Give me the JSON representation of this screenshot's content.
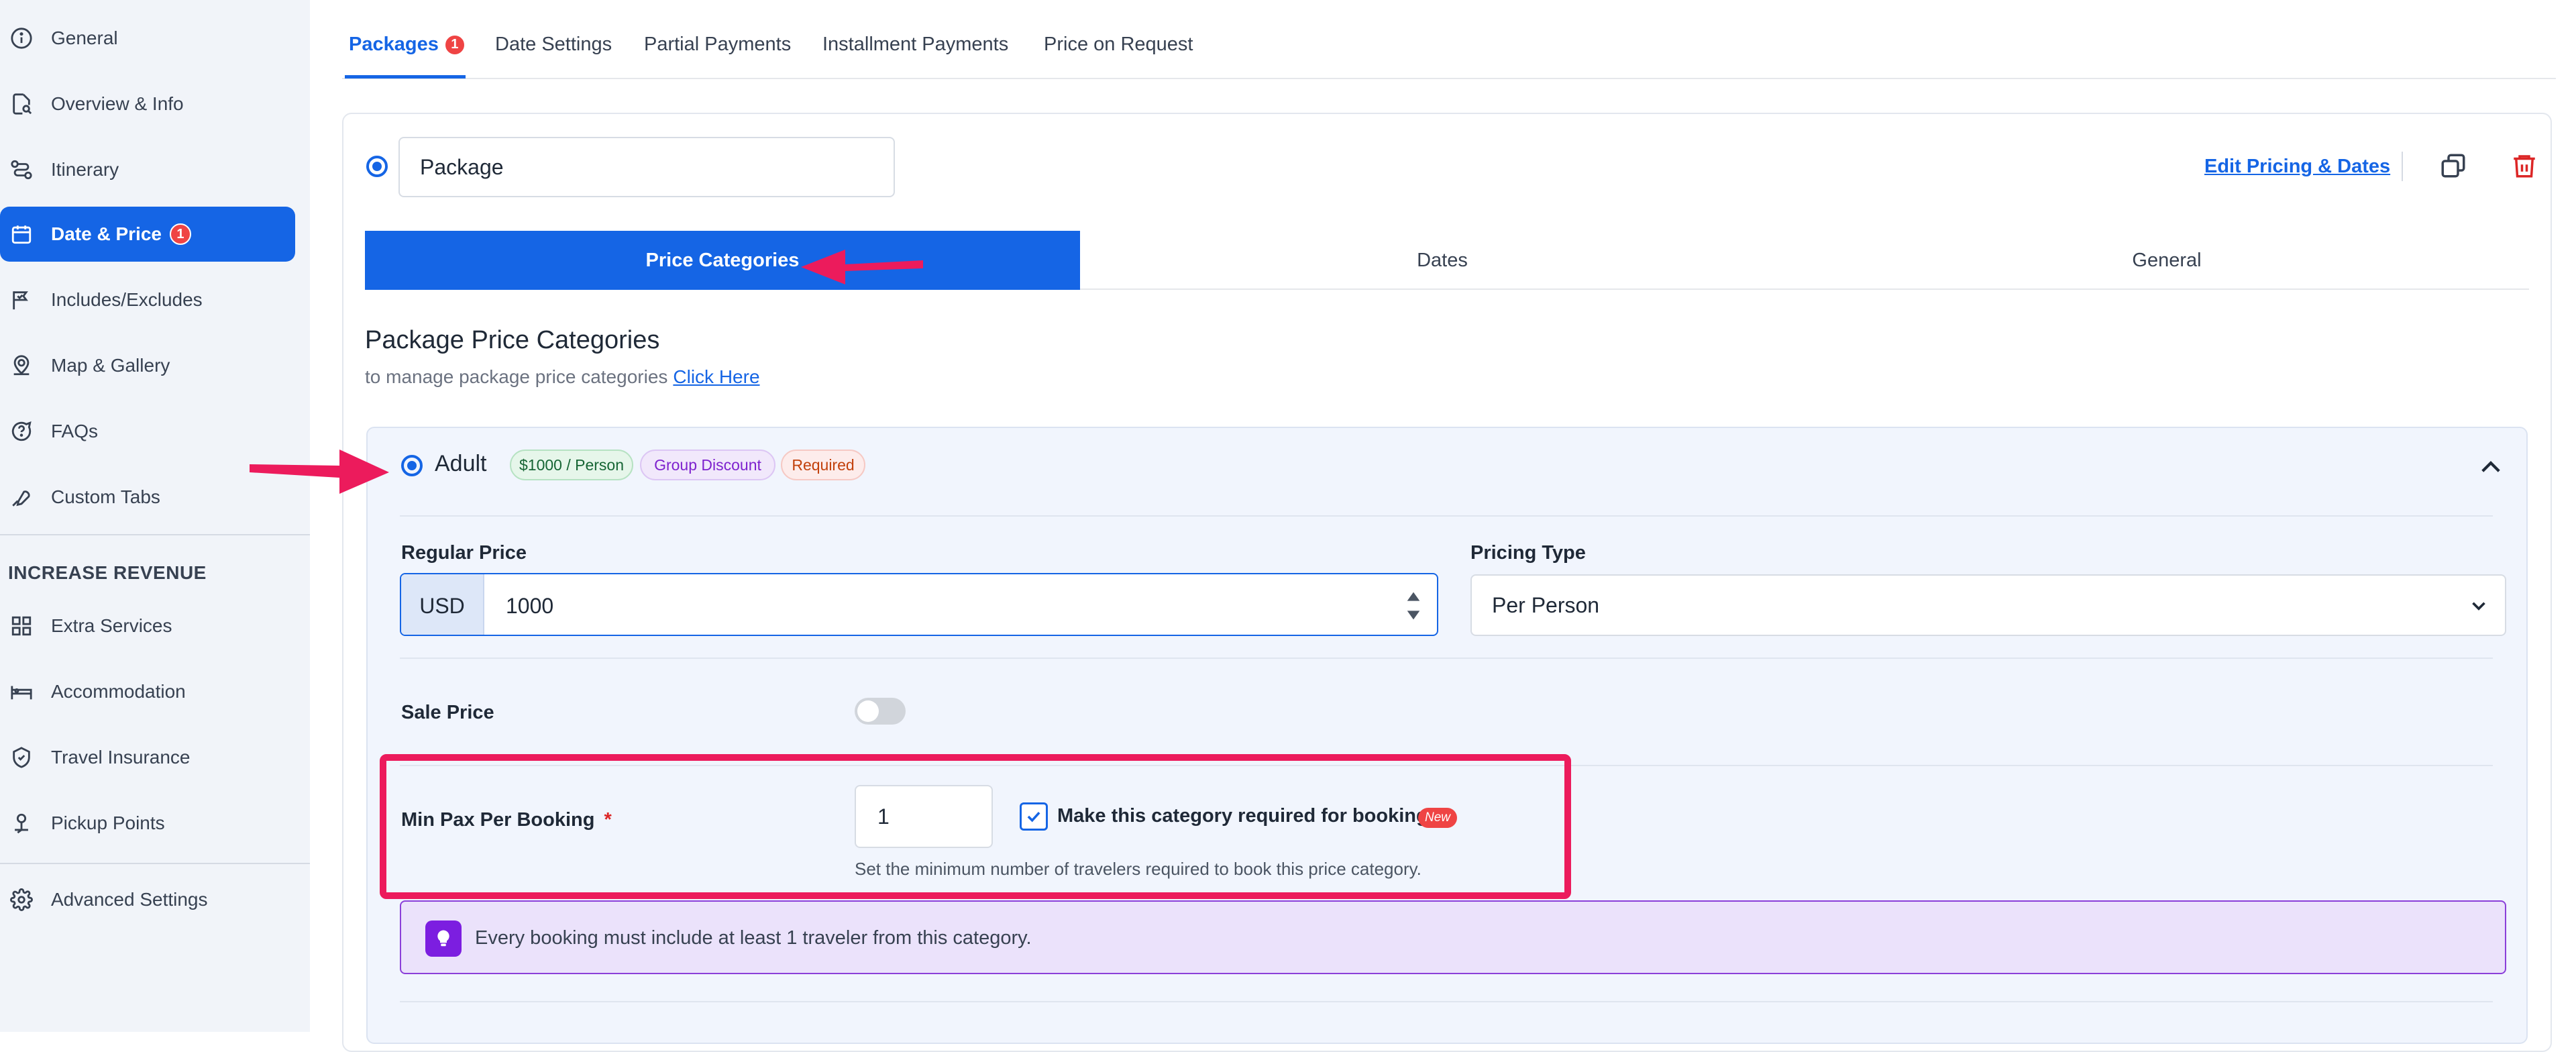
{
  "sidebar": {
    "items": [
      {
        "label": "General",
        "icon": "info-icon"
      },
      {
        "label": "Overview & Info",
        "icon": "document-search-icon"
      },
      {
        "label": "Itinerary",
        "icon": "route-icon"
      },
      {
        "label": "Date & Price",
        "icon": "calendar-icon",
        "badge": "1",
        "active": true
      },
      {
        "label": "Includes/Excludes",
        "icon": "flag-icon"
      },
      {
        "label": "Map & Gallery",
        "icon": "map-pin-icon"
      },
      {
        "label": "FAQs",
        "icon": "question-bubble-icon"
      },
      {
        "label": "Custom Tabs",
        "icon": "wrench-icon"
      }
    ],
    "revenue_heading": "INCREASE REVENUE",
    "revenue_items": [
      {
        "label": "Extra Services",
        "icon": "grid-icon"
      },
      {
        "label": "Accommodation",
        "icon": "bed-icon"
      },
      {
        "label": "Travel Insurance",
        "icon": "shield-icon"
      },
      {
        "label": "Pickup Points",
        "icon": "pickup-pin-icon"
      }
    ],
    "advanced": {
      "label": "Advanced Settings",
      "icon": "gear-icon"
    }
  },
  "top_tabs": [
    {
      "label": "Packages",
      "badge": "1",
      "active": true
    },
    {
      "label": "Date Settings"
    },
    {
      "label": "Partial Payments"
    },
    {
      "label": "Installment Payments"
    },
    {
      "label": "Price on Request"
    }
  ],
  "package": {
    "name_value": "Package",
    "edit_link": "Edit Pricing & Dates"
  },
  "inner_tabs": [
    {
      "label": "Price Categories",
      "active": true
    },
    {
      "label": "Dates"
    },
    {
      "label": "General"
    }
  ],
  "section": {
    "title": "Package Price Categories",
    "subtitle": "to manage package price categories",
    "link": "Click Here"
  },
  "category": {
    "name": "Adult",
    "chips": [
      "$1000 / Person",
      "Group Discount",
      "Required"
    ],
    "regular_price_label": "Regular Price",
    "currency": "USD",
    "price_value": "1000",
    "pricing_type_label": "Pricing Type",
    "pricing_type_value": "Per Person",
    "sale_price_label": "Sale Price",
    "min_pax_label": "Min Pax Per Booking",
    "required_mark": "*",
    "min_pax_value": "1",
    "required_checkbox_label": "Make this category required for booking",
    "new_badge": "New",
    "help_text": "Set the minimum number of travelers required to book this price category.",
    "notice": "Every booking must include at least 1 traveler from this category."
  },
  "colors": {
    "accent": "#1565e5",
    "annotation": "#ec1b5c",
    "notice_bg": "#ebe2fb",
    "notice_border": "#8b3fd9"
  }
}
